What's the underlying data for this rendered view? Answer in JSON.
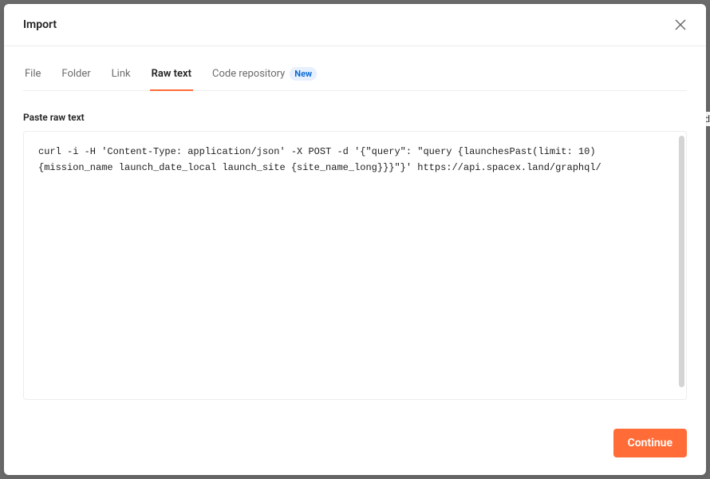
{
  "modal": {
    "title": "Import"
  },
  "tabs": [
    {
      "label": "File",
      "active": false
    },
    {
      "label": "Folder",
      "active": false
    },
    {
      "label": "Link",
      "active": false
    },
    {
      "label": "Raw text",
      "active": true
    },
    {
      "label": "Code repository",
      "active": false,
      "badge": "New"
    }
  ],
  "section": {
    "label": "Paste raw text"
  },
  "textarea": {
    "value": "curl -i -H 'Content-Type: application/json' -X POST -d '{\"query\": \"query {launchesPast(limit: 10) {mission_name launch_date_local launch_site {site_name_long}}}\"}' https://api.spacex.land/graphql/"
  },
  "footer": {
    "continue_label": "Continue"
  }
}
